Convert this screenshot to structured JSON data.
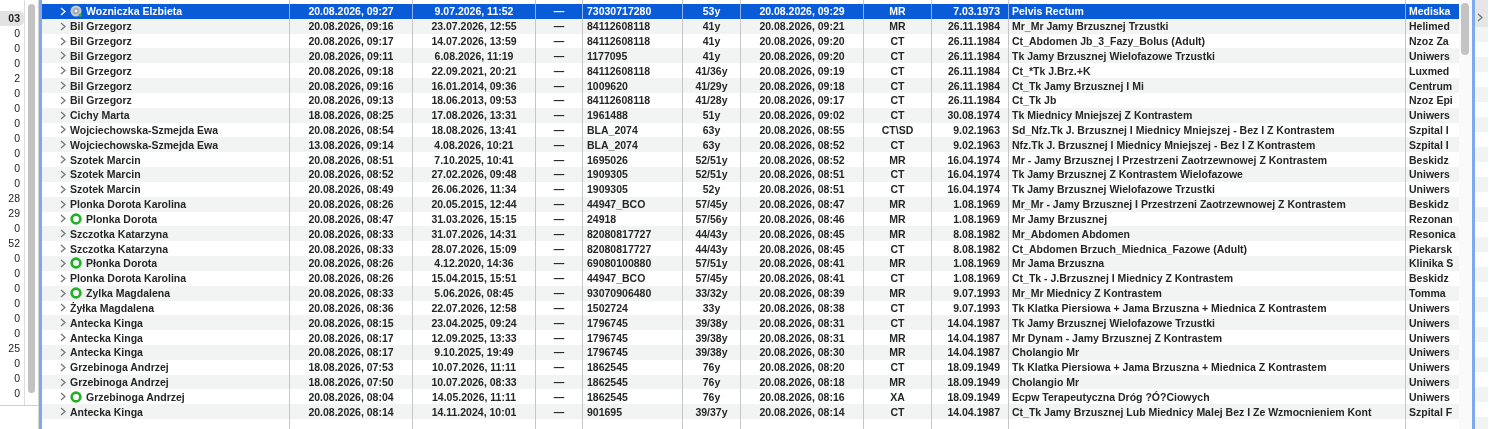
{
  "side_counts": [
    {
      "value": "03",
      "selected": true
    },
    {
      "value": "0",
      "selected": false
    },
    {
      "value": "0",
      "selected": false
    },
    {
      "value": "0",
      "selected": false
    },
    {
      "value": "2",
      "selected": false
    },
    {
      "value": "0",
      "selected": false
    },
    {
      "value": "0",
      "selected": false
    },
    {
      "value": "0",
      "selected": false
    },
    {
      "value": "0",
      "selected": false
    },
    {
      "value": "0",
      "selected": false
    },
    {
      "value": "0",
      "selected": false
    },
    {
      "value": "0",
      "selected": false
    },
    {
      "value": "28",
      "selected": false
    },
    {
      "value": "29",
      "selected": false
    },
    {
      "value": "0",
      "selected": false
    },
    {
      "value": "52",
      "selected": false
    },
    {
      "value": "0",
      "selected": false
    },
    {
      "value": "0",
      "selected": false
    },
    {
      "value": "0",
      "selected": false
    },
    {
      "value": "0",
      "selected": false
    },
    {
      "value": "0",
      "selected": false
    },
    {
      "value": "0",
      "selected": false
    },
    {
      "value": "25",
      "selected": false
    },
    {
      "value": "0",
      "selected": false
    },
    {
      "value": "0",
      "selected": false
    },
    {
      "value": "0",
      "selected": false
    }
  ],
  "table": {
    "rows": [
      {
        "name": "Wozniczka Elzbieta",
        "kind": "disc",
        "selected": true,
        "cells": [
          "20.08.2026, 09:27",
          "9.07.2026, 11:52",
          "—",
          "73030717280",
          "53y",
          "20.08.2026, 09:29",
          "MR",
          "7.03.1973",
          "Pelvis Rectum",
          "Mediska"
        ]
      },
      {
        "name": "Bil Grzegorz",
        "selected": false,
        "cells": [
          "20.08.2026, 09:16",
          "23.07.2026, 12:55",
          "—",
          "84112608118",
          "41y",
          "20.08.2026, 09:21",
          "MR",
          "26.11.1984",
          "Mr_Mr Jamy Brzusznej Trzustki",
          "Helimed"
        ]
      },
      {
        "name": "Bil Grzegorz",
        "selected": false,
        "cells": [
          "20.08.2026, 09:17",
          "14.07.2026, 13:59",
          "—",
          "84112608118",
          "41y",
          "20.08.2026, 09:20",
          "CT",
          "26.11.1984",
          "Ct_Abdomen Jb_3_Fazy_Bolus (Adult)",
          "Nzoz Za"
        ]
      },
      {
        "name": "Bil Grzegorz",
        "selected": false,
        "cells": [
          "20.08.2026, 09:11",
          "6.08.2026, 11:19",
          "—",
          "1177095",
          "41y",
          "20.08.2026, 09:20",
          "CT",
          "26.11.1984",
          "Tk Jamy Brzusznej Wielofazowe Trzustki",
          "Uniwers"
        ]
      },
      {
        "name": "Bil Grzegorz",
        "selected": false,
        "cells": [
          "20.08.2026, 09:18",
          "22.09.2021, 20:21",
          "—",
          "84112608118",
          "41/36y",
          "20.08.2026, 09:19",
          "CT",
          "26.11.1984",
          "Ct_*Tk J.Brz.+K",
          "Luxmed"
        ]
      },
      {
        "name": "Bil Grzegorz",
        "selected": false,
        "cells": [
          "20.08.2026, 09:16",
          "16.01.2014, 09:36",
          "—",
          "1009620",
          "41/29y",
          "20.08.2026, 09:18",
          "CT",
          "26.11.1984",
          "Ct_Tk Jamy Brzusznej I Mi",
          "Centrum"
        ]
      },
      {
        "name": "Bil Grzegorz",
        "selected": false,
        "cells": [
          "20.08.2026, 09:13",
          "18.06.2013, 09:53",
          "—",
          "84112608118",
          "41/28y",
          "20.08.2026, 09:17",
          "CT",
          "26.11.1984",
          "Ct_Tk Jb",
          "Nzoz Epi"
        ]
      },
      {
        "name": "Cichy Marta",
        "selected": false,
        "cells": [
          "18.08.2026, 08:25",
          "17.08.2026, 13:31",
          "—",
          "1961488",
          "51y",
          "20.08.2026, 09:02",
          "CT",
          "30.08.1974",
          "Tk Miednicy Mniejszej Z Kontrastem",
          "Uniwers"
        ]
      },
      {
        "name": "Wojciechowska-Szmejda Ewa",
        "selected": false,
        "cells": [
          "20.08.2026, 08:54",
          "18.08.2026, 13:41",
          "—",
          "BLA_2074",
          "63y",
          "20.08.2026, 08:55",
          "CT\\SD",
          "9.02.1963",
          "Sd_Nfz.Tk J. Brzusznej I Miednicy Mniejszej - Bez I Z Kontrastem",
          "Szpital I"
        ]
      },
      {
        "name": "Wojciechowska-Szmejda Ewa",
        "selected": false,
        "cells": [
          "13.08.2026, 09:14",
          "4.08.2026, 10:21",
          "—",
          "BLA_2074",
          "63y",
          "20.08.2026, 08:52",
          "CT",
          "9.02.1963",
          "Nfz.Tk J. Brzusznej I Miednicy Mniejszej - Bez I Z Kontrastem",
          "Szpital I"
        ]
      },
      {
        "name": "Szotek Marcin",
        "selected": false,
        "cells": [
          "20.08.2026, 08:51",
          "7.10.2025, 10:41",
          "—",
          "1695026",
          "52/51y",
          "20.08.2026, 08:52",
          "MR",
          "16.04.1974",
          "Mr - Jamy Brzusznej I Przestrzeni Zaotrzewnowej Z Kontrastem",
          "Beskidz"
        ]
      },
      {
        "name": "Szotek Marcin",
        "selected": false,
        "cells": [
          "20.08.2026, 08:52",
          "27.02.2026, 09:48",
          "—",
          "1909305",
          "52/51y",
          "20.08.2026, 08:51",
          "CT",
          "16.04.1974",
          "Tk Jamy Brzusznej Z Kontrastem Wielofazowe",
          "Uniwers"
        ]
      },
      {
        "name": "Szotek Marcin",
        "selected": false,
        "cells": [
          "20.08.2026, 08:49",
          "26.06.2026, 11:34",
          "—",
          "1909305",
          "52y",
          "20.08.2026, 08:51",
          "CT",
          "16.04.1974",
          "Tk Jamy Brzusznej Wielofazowe Trzustki",
          "Uniwers"
        ]
      },
      {
        "name": "Plonka Dorota Karolina",
        "selected": false,
        "cells": [
          "20.08.2026, 08:26",
          "20.05.2015, 12:44",
          "—",
          "44947_BCO",
          "57/45y",
          "20.08.2026, 08:47",
          "MR",
          "1.08.1969",
          "Mr_Mr - Jamy Brzusznej I Przestrzeni Zaotrzewnowej Z Kontrastem",
          "Beskidz"
        ]
      },
      {
        "name": "Plonka Dorota",
        "kind": "ring",
        "selected": false,
        "cells": [
          "20.08.2026, 08:47",
          "31.03.2026, 15:15",
          "—",
          "24918",
          "57/56y",
          "20.08.2026, 08:46",
          "MR",
          "1.08.1969",
          "Mr Jamy Brzusznej",
          "Rezonan"
        ]
      },
      {
        "name": "Szczotka Katarzyna",
        "selected": false,
        "cells": [
          "20.08.2026, 08:33",
          "31.07.2026, 14:31",
          "—",
          "82080817727",
          "44/43y",
          "20.08.2026, 08:45",
          "MR",
          "8.08.1982",
          "Mr_Abdomen Abdomen",
          "Resonica"
        ]
      },
      {
        "name": "Szczotka Katarzyna",
        "selected": false,
        "cells": [
          "20.08.2026, 08:33",
          "28.07.2026, 15:09",
          "—",
          "82080817727",
          "44/43y",
          "20.08.2026, 08:45",
          "CT",
          "8.08.1982",
          "Ct_Abdomen Brzuch_Miednica_Fazowe (Adult)",
          "Piekarsk"
        ]
      },
      {
        "name": "Płonka Dorota",
        "kind": "ring",
        "selected": false,
        "cells": [
          "20.08.2026, 08:26",
          "4.12.2020, 14:36",
          "—",
          "69080100880",
          "57/51y",
          "20.08.2026, 08:41",
          "MR",
          "1.08.1969",
          "Mr Jama Brzuszna",
          "Klinika S"
        ]
      },
      {
        "name": "Plonka Dorota Karolina",
        "selected": false,
        "cells": [
          "20.08.2026, 08:26",
          "15.04.2015, 15:51",
          "—",
          "44947_BCO",
          "57/45y",
          "20.08.2026, 08:41",
          "CT",
          "1.08.1969",
          "Ct_Tk - J.Brzusznej I Miednicy Z Kontrastem",
          "Beskidz"
        ]
      },
      {
        "name": "Zylka Magdalena",
        "kind": "ring",
        "selected": false,
        "cells": [
          "20.08.2026, 08:33",
          "5.06.2026, 08:45",
          "—",
          "93070906480",
          "33/32y",
          "20.08.2026, 08:39",
          "MR",
          "9.07.1993",
          "Mr_Mr Miednicy Z Kontrastem",
          "Tomma"
        ]
      },
      {
        "name": "Żyłka Magdalena",
        "selected": false,
        "cells": [
          "20.08.2026, 08:36",
          "22.07.2026, 12:58",
          "—",
          "1502724",
          "33y",
          "20.08.2026, 08:38",
          "CT",
          "9.07.1993",
          "Tk Klatka Piersiowa + Jama Brzuszna + Miednica Z Kontrastem",
          "Uniwers"
        ]
      },
      {
        "name": "Antecka Kinga",
        "selected": false,
        "cells": [
          "20.08.2026, 08:15",
          "23.04.2025, 09:24",
          "—",
          "1796745",
          "39/38y",
          "20.08.2026, 08:31",
          "CT",
          "14.04.1987",
          "Tk Jamy Brzusznej Wielofazowe Trzustki",
          "Uniwers"
        ]
      },
      {
        "name": "Antecka Kinga",
        "selected": false,
        "cells": [
          "20.08.2026, 08:17",
          "12.09.2025, 13:33",
          "—",
          "1796745",
          "39/38y",
          "20.08.2026, 08:31",
          "MR",
          "14.04.1987",
          "Mr Dynam - Jamy Brzusznej Z Kontrastem",
          "Uniwers"
        ]
      },
      {
        "name": "Antecka Kinga",
        "selected": false,
        "cells": [
          "20.08.2026, 08:17",
          "9.10.2025, 19:49",
          "—",
          "1796745",
          "39/38y",
          "20.08.2026, 08:30",
          "MR",
          "14.04.1987",
          "Cholangio Mr",
          "Uniwers"
        ]
      },
      {
        "name": "Grzebinoga Andrzej",
        "selected": false,
        "cells": [
          "18.08.2026, 07:53",
          "10.07.2026, 11:11",
          "—",
          "1862545",
          "76y",
          "20.08.2026, 08:20",
          "CT",
          "18.09.1949",
          "Tk Klatka Piersiowa + Jama Brzuszna + Miednica Z Kontrastem",
          "Uniwers"
        ]
      },
      {
        "name": "Grzebinoga Andrzej",
        "selected": false,
        "cells": [
          "18.08.2026, 07:50",
          "10.07.2026, 08:33",
          "—",
          "1862545",
          "76y",
          "20.08.2026, 08:18",
          "MR",
          "18.09.1949",
          "Cholangio Mr",
          "Uniwers"
        ]
      },
      {
        "name": "Grzebinoga Andrzej",
        "kind": "ring",
        "selected": false,
        "cells": [
          "20.08.2026, 08:04",
          "14.05.2026, 11:11",
          "—",
          "1862545",
          "76y",
          "20.08.2026, 08:16",
          "XA",
          "18.09.1949",
          "Ecpw Terapeutyczna Dróg ?Ó?Ciowych",
          "Uniwers"
        ]
      },
      {
        "name": "Antecka Kinga",
        "selected": false,
        "cells": [
          "20.08.2026, 08:14",
          "14.11.2024, 10:01",
          "—",
          "901695",
          "39/37y",
          "20.08.2026, 08:14",
          "CT",
          "14.04.1987",
          "Ct_Tk Jamy Brzusznej Lub Miednicy Malej Bez I Ze Wzmocnieniem Kont",
          "Szpital F"
        ]
      }
    ]
  }
}
